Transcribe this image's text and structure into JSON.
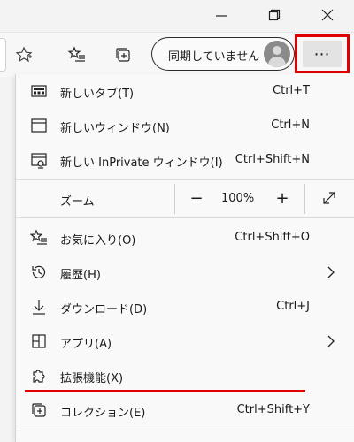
{
  "window": {
    "minimize_icon": "minimize-icon",
    "maximize_icon": "restore-icon",
    "close_icon": "close-icon"
  },
  "toolbar": {
    "sync_label": "同期していません",
    "more_label": "⋯",
    "favorite_icon": "star-icon",
    "favorites_icon": "favorites-list-icon",
    "collections_icon": "collections-icon",
    "highlight_color": "#e10000"
  },
  "menu": {
    "items": [
      {
        "label": "新しいタブ(T)",
        "shortcut": "Ctrl+T",
        "icon": "new-tab-icon"
      },
      {
        "label": "新しいウィンドウ(N)",
        "shortcut": "Ctrl+N",
        "icon": "new-window-icon"
      },
      {
        "label": "新しい InPrivate ウィンドウ(I)",
        "shortcut": "Ctrl+Shift+N",
        "icon": "inprivate-icon"
      }
    ],
    "zoom": {
      "label": "ズーム",
      "minus": "−",
      "value": "100%",
      "plus": "+",
      "fullscreen_icon": "fullscreen-icon"
    },
    "items2": [
      {
        "label": "お気に入り(O)",
        "shortcut": "Ctrl+Shift+O",
        "icon": "favorites-icon"
      },
      {
        "label": "履歴(H)",
        "shortcut": "",
        "icon": "history-icon"
      },
      {
        "label": "ダウンロード(D)",
        "shortcut": "Ctrl+J",
        "icon": "download-icon"
      },
      {
        "label": "アプリ(A)",
        "shortcut": "",
        "icon": "apps-icon"
      },
      {
        "label": "拡張機能(X)",
        "shortcut": "",
        "icon": "extensions-icon"
      },
      {
        "label": "コレクション(E)",
        "shortcut": "Ctrl+Shift+Y",
        "icon": "collections-icon"
      }
    ]
  }
}
